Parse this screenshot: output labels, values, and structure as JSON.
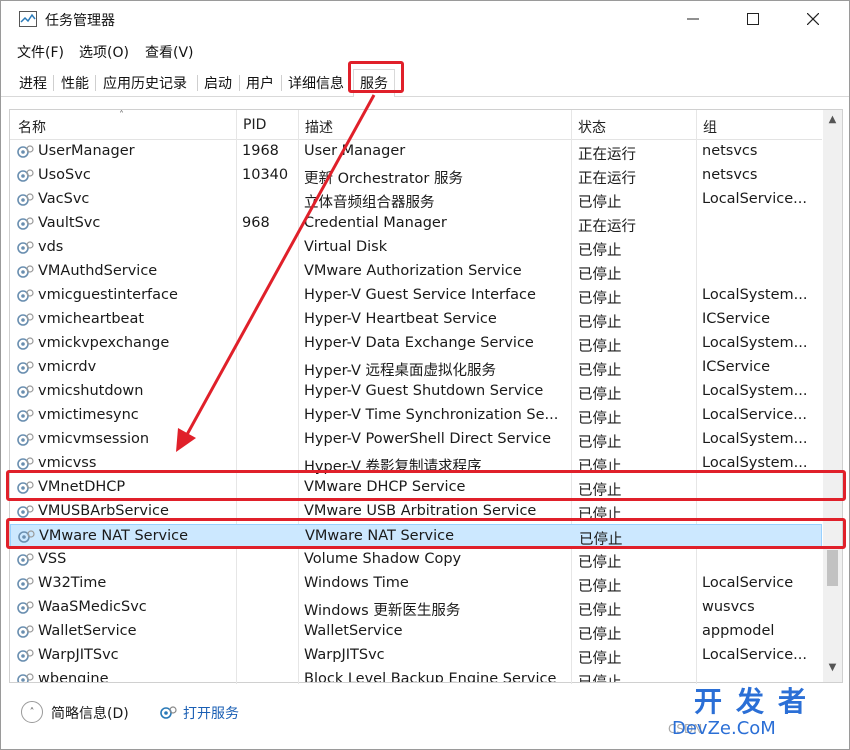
{
  "window": {
    "title": "任务管理器"
  },
  "menu": [
    "文件(F)",
    "选项(O)",
    "查看(V)"
  ],
  "tabs": [
    "进程",
    "性能",
    "应用历史记录",
    "启动",
    "用户",
    "详细信息",
    "服务"
  ],
  "active_tab": "服务",
  "columns": {
    "name": "名称",
    "pid": "PID",
    "desc": "描述",
    "status": "状态",
    "group": "组"
  },
  "rows": [
    {
      "name": "UserManager",
      "pid": "1968",
      "desc": "User Manager",
      "status": "正在运行",
      "group": "netsvcs"
    },
    {
      "name": "UsoSvc",
      "pid": "10340",
      "desc": "更新 Orchestrator 服务",
      "status": "正在运行",
      "group": "netsvcs"
    },
    {
      "name": "VacSvc",
      "pid": "",
      "desc": "立体音频组合器服务",
      "status": "已停止",
      "group": "LocalService..."
    },
    {
      "name": "VaultSvc",
      "pid": "968",
      "desc": "Credential Manager",
      "status": "正在运行",
      "group": ""
    },
    {
      "name": "vds",
      "pid": "",
      "desc": "Virtual Disk",
      "status": "已停止",
      "group": ""
    },
    {
      "name": "VMAuthdService",
      "pid": "",
      "desc": "VMware Authorization Service",
      "status": "已停止",
      "group": ""
    },
    {
      "name": "vmicguestinterface",
      "pid": "",
      "desc": "Hyper-V Guest Service Interface",
      "status": "已停止",
      "group": "LocalSystem..."
    },
    {
      "name": "vmicheartbeat",
      "pid": "",
      "desc": "Hyper-V Heartbeat Service",
      "status": "已停止",
      "group": "ICService"
    },
    {
      "name": "vmickvpexchange",
      "pid": "",
      "desc": "Hyper-V Data Exchange Service",
      "status": "已停止",
      "group": "LocalSystem..."
    },
    {
      "name": "vmicrdv",
      "pid": "",
      "desc": "Hyper-V 远程桌面虚拟化服务",
      "status": "已停止",
      "group": "ICService"
    },
    {
      "name": "vmicshutdown",
      "pid": "",
      "desc": "Hyper-V Guest Shutdown Service",
      "status": "已停止",
      "group": "LocalSystem..."
    },
    {
      "name": "vmictimesync",
      "pid": "",
      "desc": "Hyper-V Time Synchronization Se...",
      "status": "已停止",
      "group": "LocalService..."
    },
    {
      "name": "vmicvmsession",
      "pid": "",
      "desc": "Hyper-V PowerShell Direct Service",
      "status": "已停止",
      "group": "LocalSystem..."
    },
    {
      "name": "vmicvss",
      "pid": "",
      "desc": "Hyper-V 卷影复制请求程序",
      "status": "已停止",
      "group": "LocalSystem..."
    },
    {
      "name": "VMnetDHCP",
      "pid": "",
      "desc": "VMware DHCP Service",
      "status": "已停止",
      "group": ""
    },
    {
      "name": "VMUSBArbService",
      "pid": "",
      "desc": "VMware USB Arbitration Service",
      "status": "已停止",
      "group": ""
    },
    {
      "name": "VMware NAT Service",
      "pid": "",
      "desc": "VMware NAT Service",
      "status": "已停止",
      "group": ""
    },
    {
      "name": "VSS",
      "pid": "",
      "desc": "Volume Shadow Copy",
      "status": "已停止",
      "group": ""
    },
    {
      "name": "W32Time",
      "pid": "",
      "desc": "Windows Time",
      "status": "已停止",
      "group": "LocalService"
    },
    {
      "name": "WaaSMedicSvc",
      "pid": "",
      "desc": "Windows 更新医生服务",
      "status": "已停止",
      "group": "wusvcs"
    },
    {
      "name": "WalletService",
      "pid": "",
      "desc": "WalletService",
      "status": "已停止",
      "group": "appmodel"
    },
    {
      "name": "WarpJITSvc",
      "pid": "",
      "desc": "WarpJITSvc",
      "status": "已停止",
      "group": "LocalService..."
    },
    {
      "name": "wbengine",
      "pid": "",
      "desc": "Block Level Backup Engine Service",
      "status": "已停止",
      "group": ""
    }
  ],
  "selected_row": "VMware NAT Service",
  "footer": {
    "brief": "简略信息(D)",
    "open_services": "打开服务"
  },
  "watermark": {
    "big": "开发者",
    "small": "DevZe.CoM",
    "csdn": "CSDN"
  },
  "colors": {
    "highlight": "#e0202a",
    "selection": "#cce8ff",
    "link": "#1a5fb4"
  }
}
